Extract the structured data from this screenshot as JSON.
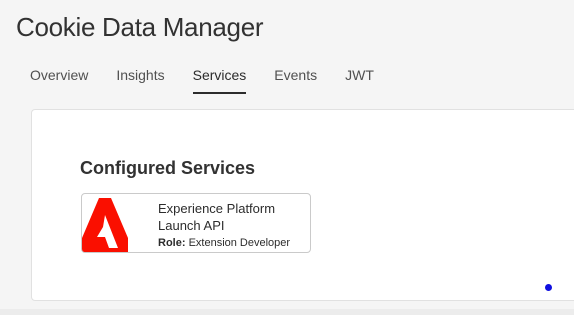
{
  "app": {
    "title": "Cookie Data Manager"
  },
  "tabs": [
    {
      "label": "Overview",
      "active": false
    },
    {
      "label": "Insights",
      "active": false
    },
    {
      "label": "Services",
      "active": true
    },
    {
      "label": "Events",
      "active": false
    },
    {
      "label": "JWT",
      "active": false
    }
  ],
  "services": {
    "section_title": "Configured Services",
    "cards": [
      {
        "name": "Experience Platform Launch API",
        "role_label": "Role:",
        "role_value": "Extension Developer",
        "logo": "adobe-logo",
        "logo_color": "#fa0f00"
      }
    ]
  },
  "indicator": {
    "color": "#1010e0"
  }
}
